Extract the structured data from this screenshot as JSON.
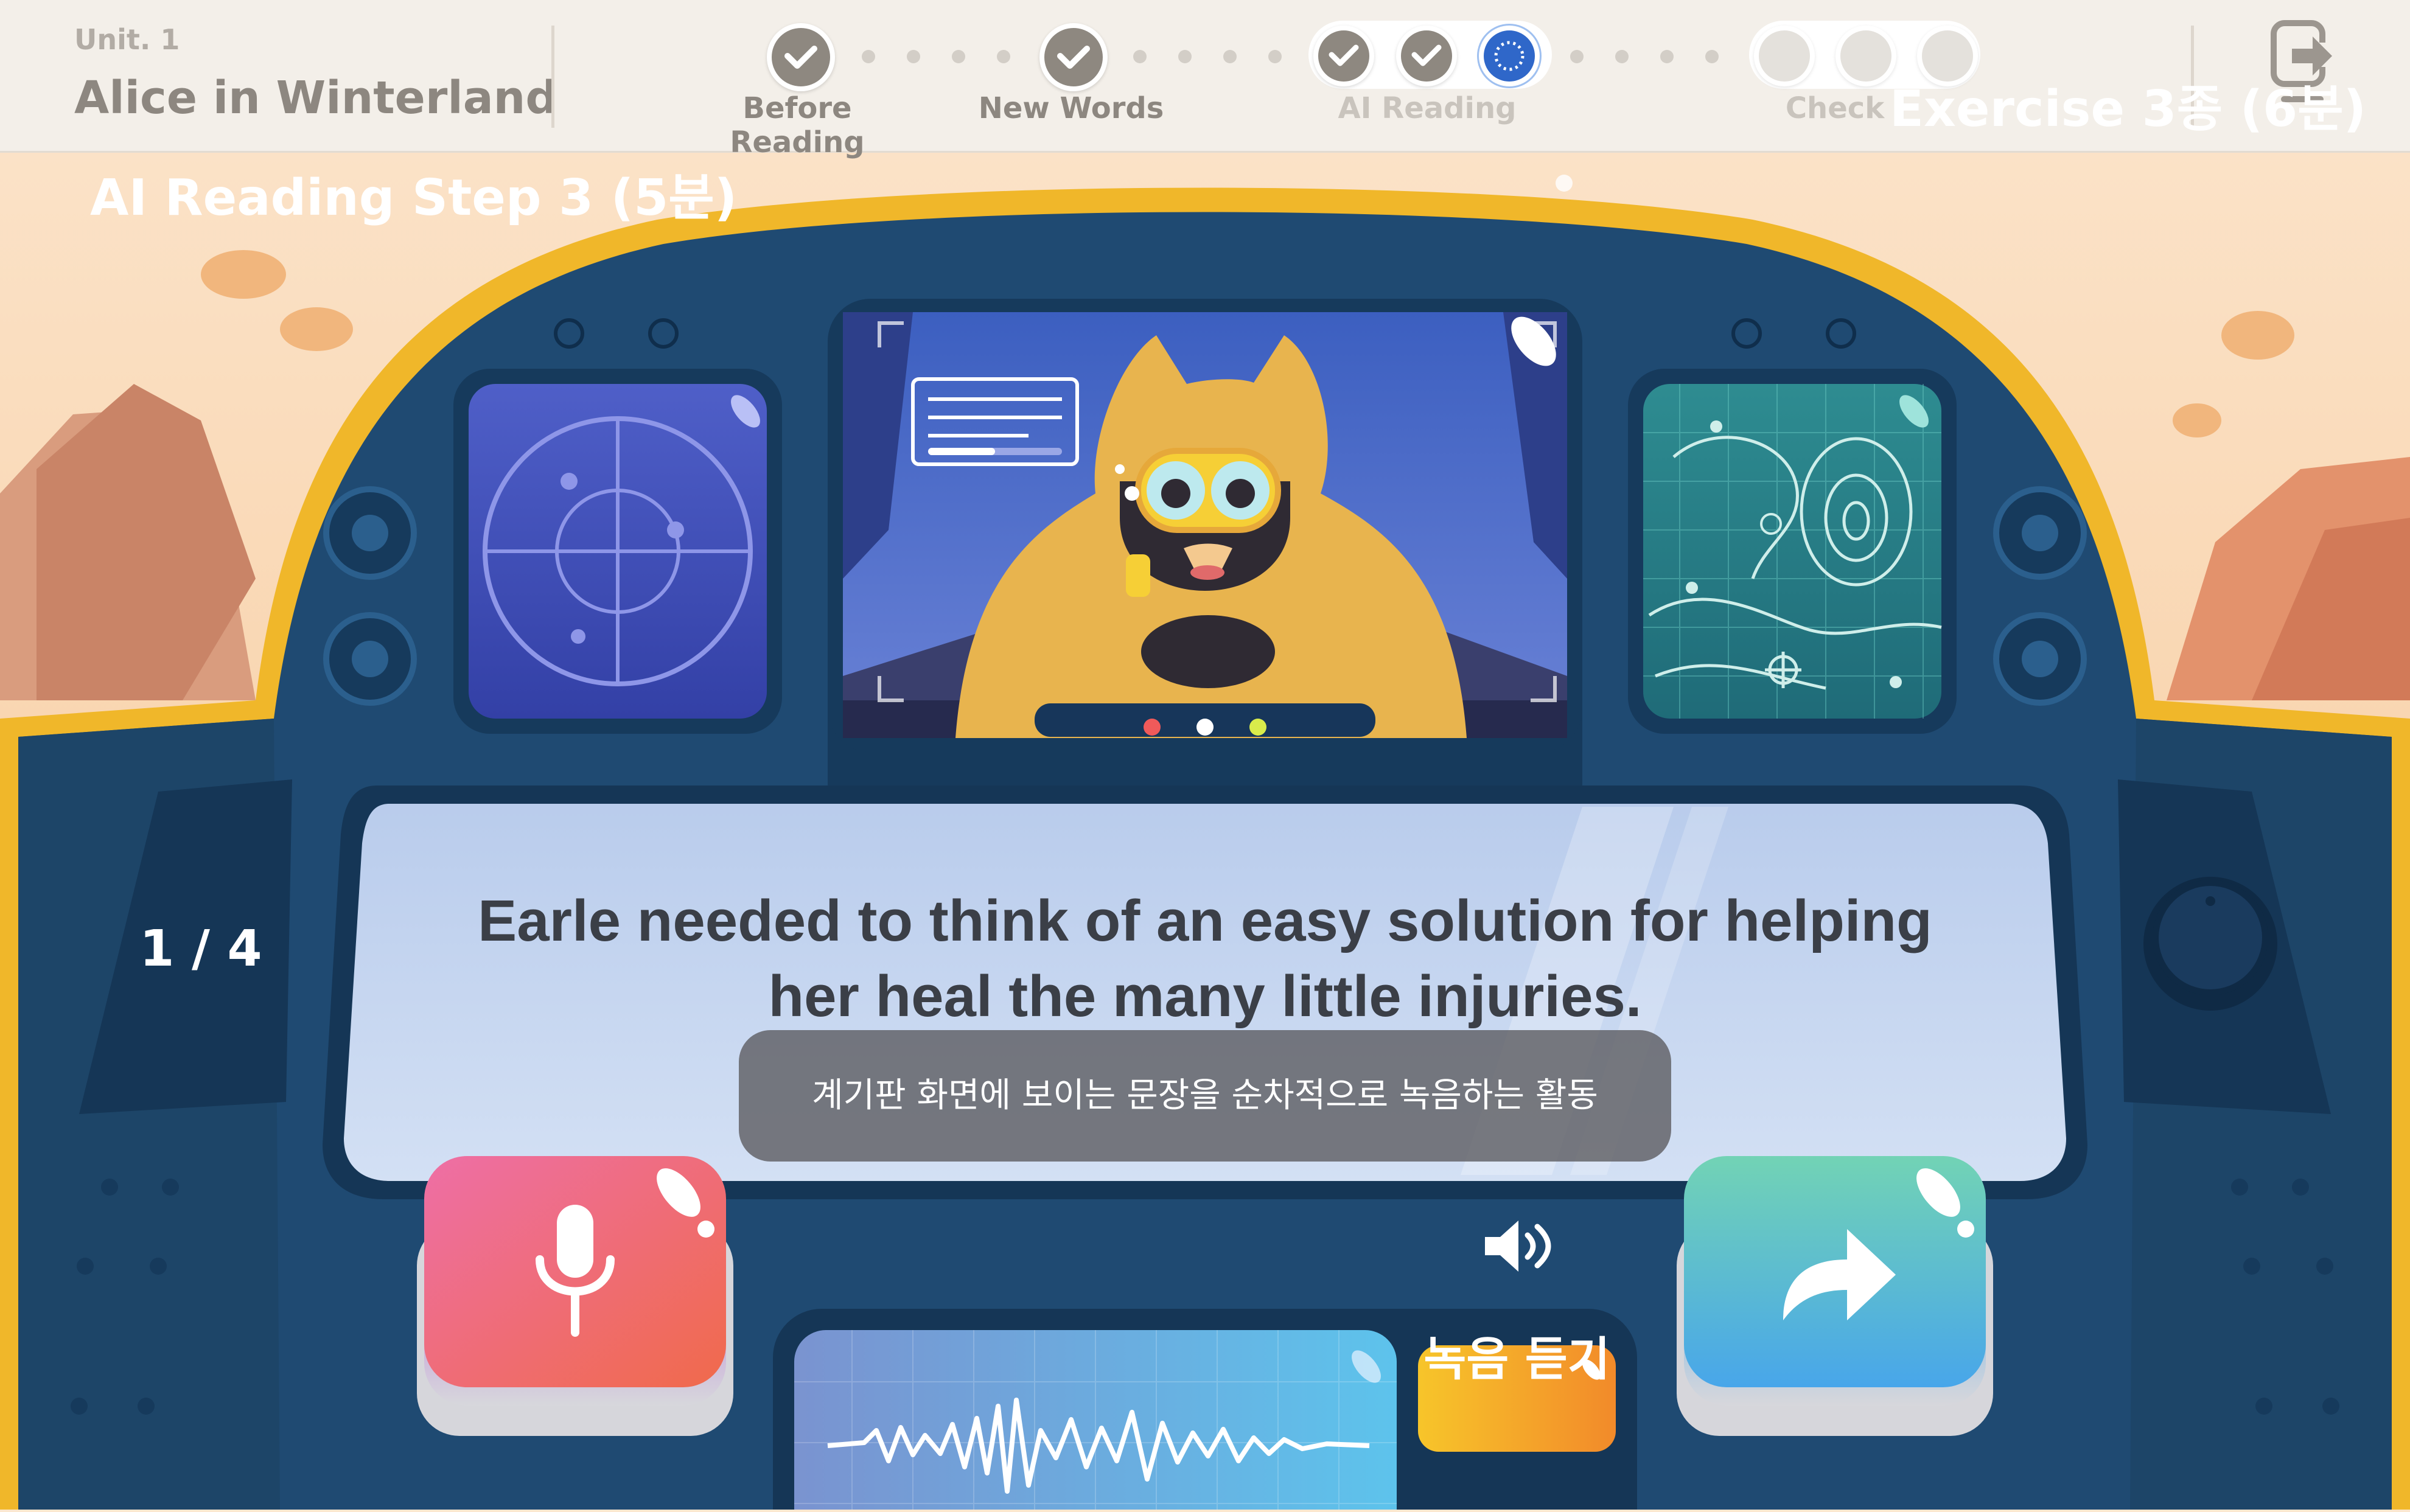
{
  "header": {
    "unit_label": "Unit. 1",
    "title": "Alice in Winterland",
    "steps": [
      {
        "label": "Before Reading",
        "state": "done"
      },
      {
        "label": "New Words",
        "state": "done"
      },
      {
        "label": "AI Reading",
        "state": "current"
      },
      {
        "label": "Check",
        "state": "todo"
      }
    ],
    "exit_icon": "exit-arrow-icon"
  },
  "overlay": {
    "step_title": "AI Reading Step 3 (5분)",
    "exercise_title": "Exercise 3종 (6분)"
  },
  "reading": {
    "counter": "1 / 4",
    "sentence_line1": "Earle needed to think of an easy solution for helping",
    "sentence_line2": "her heal the many little injuries.",
    "tooltip": "계기판 화면에 보이는 문장을 순차적으로 녹음하는 활동"
  },
  "controls": {
    "record_icon": "microphone-icon",
    "listen_label": "녹음 듣기",
    "listen_icon": "speaker-icon",
    "next_icon": "forward-arrow-icon"
  },
  "colors": {
    "dashboard": "#1f4a72",
    "dashboard_rim": "#f0b72a",
    "record_button": "#ec5f8f",
    "listen_button": "#f3a62a",
    "next_button": "#59c6c5",
    "current_step": "#2f67c9"
  }
}
